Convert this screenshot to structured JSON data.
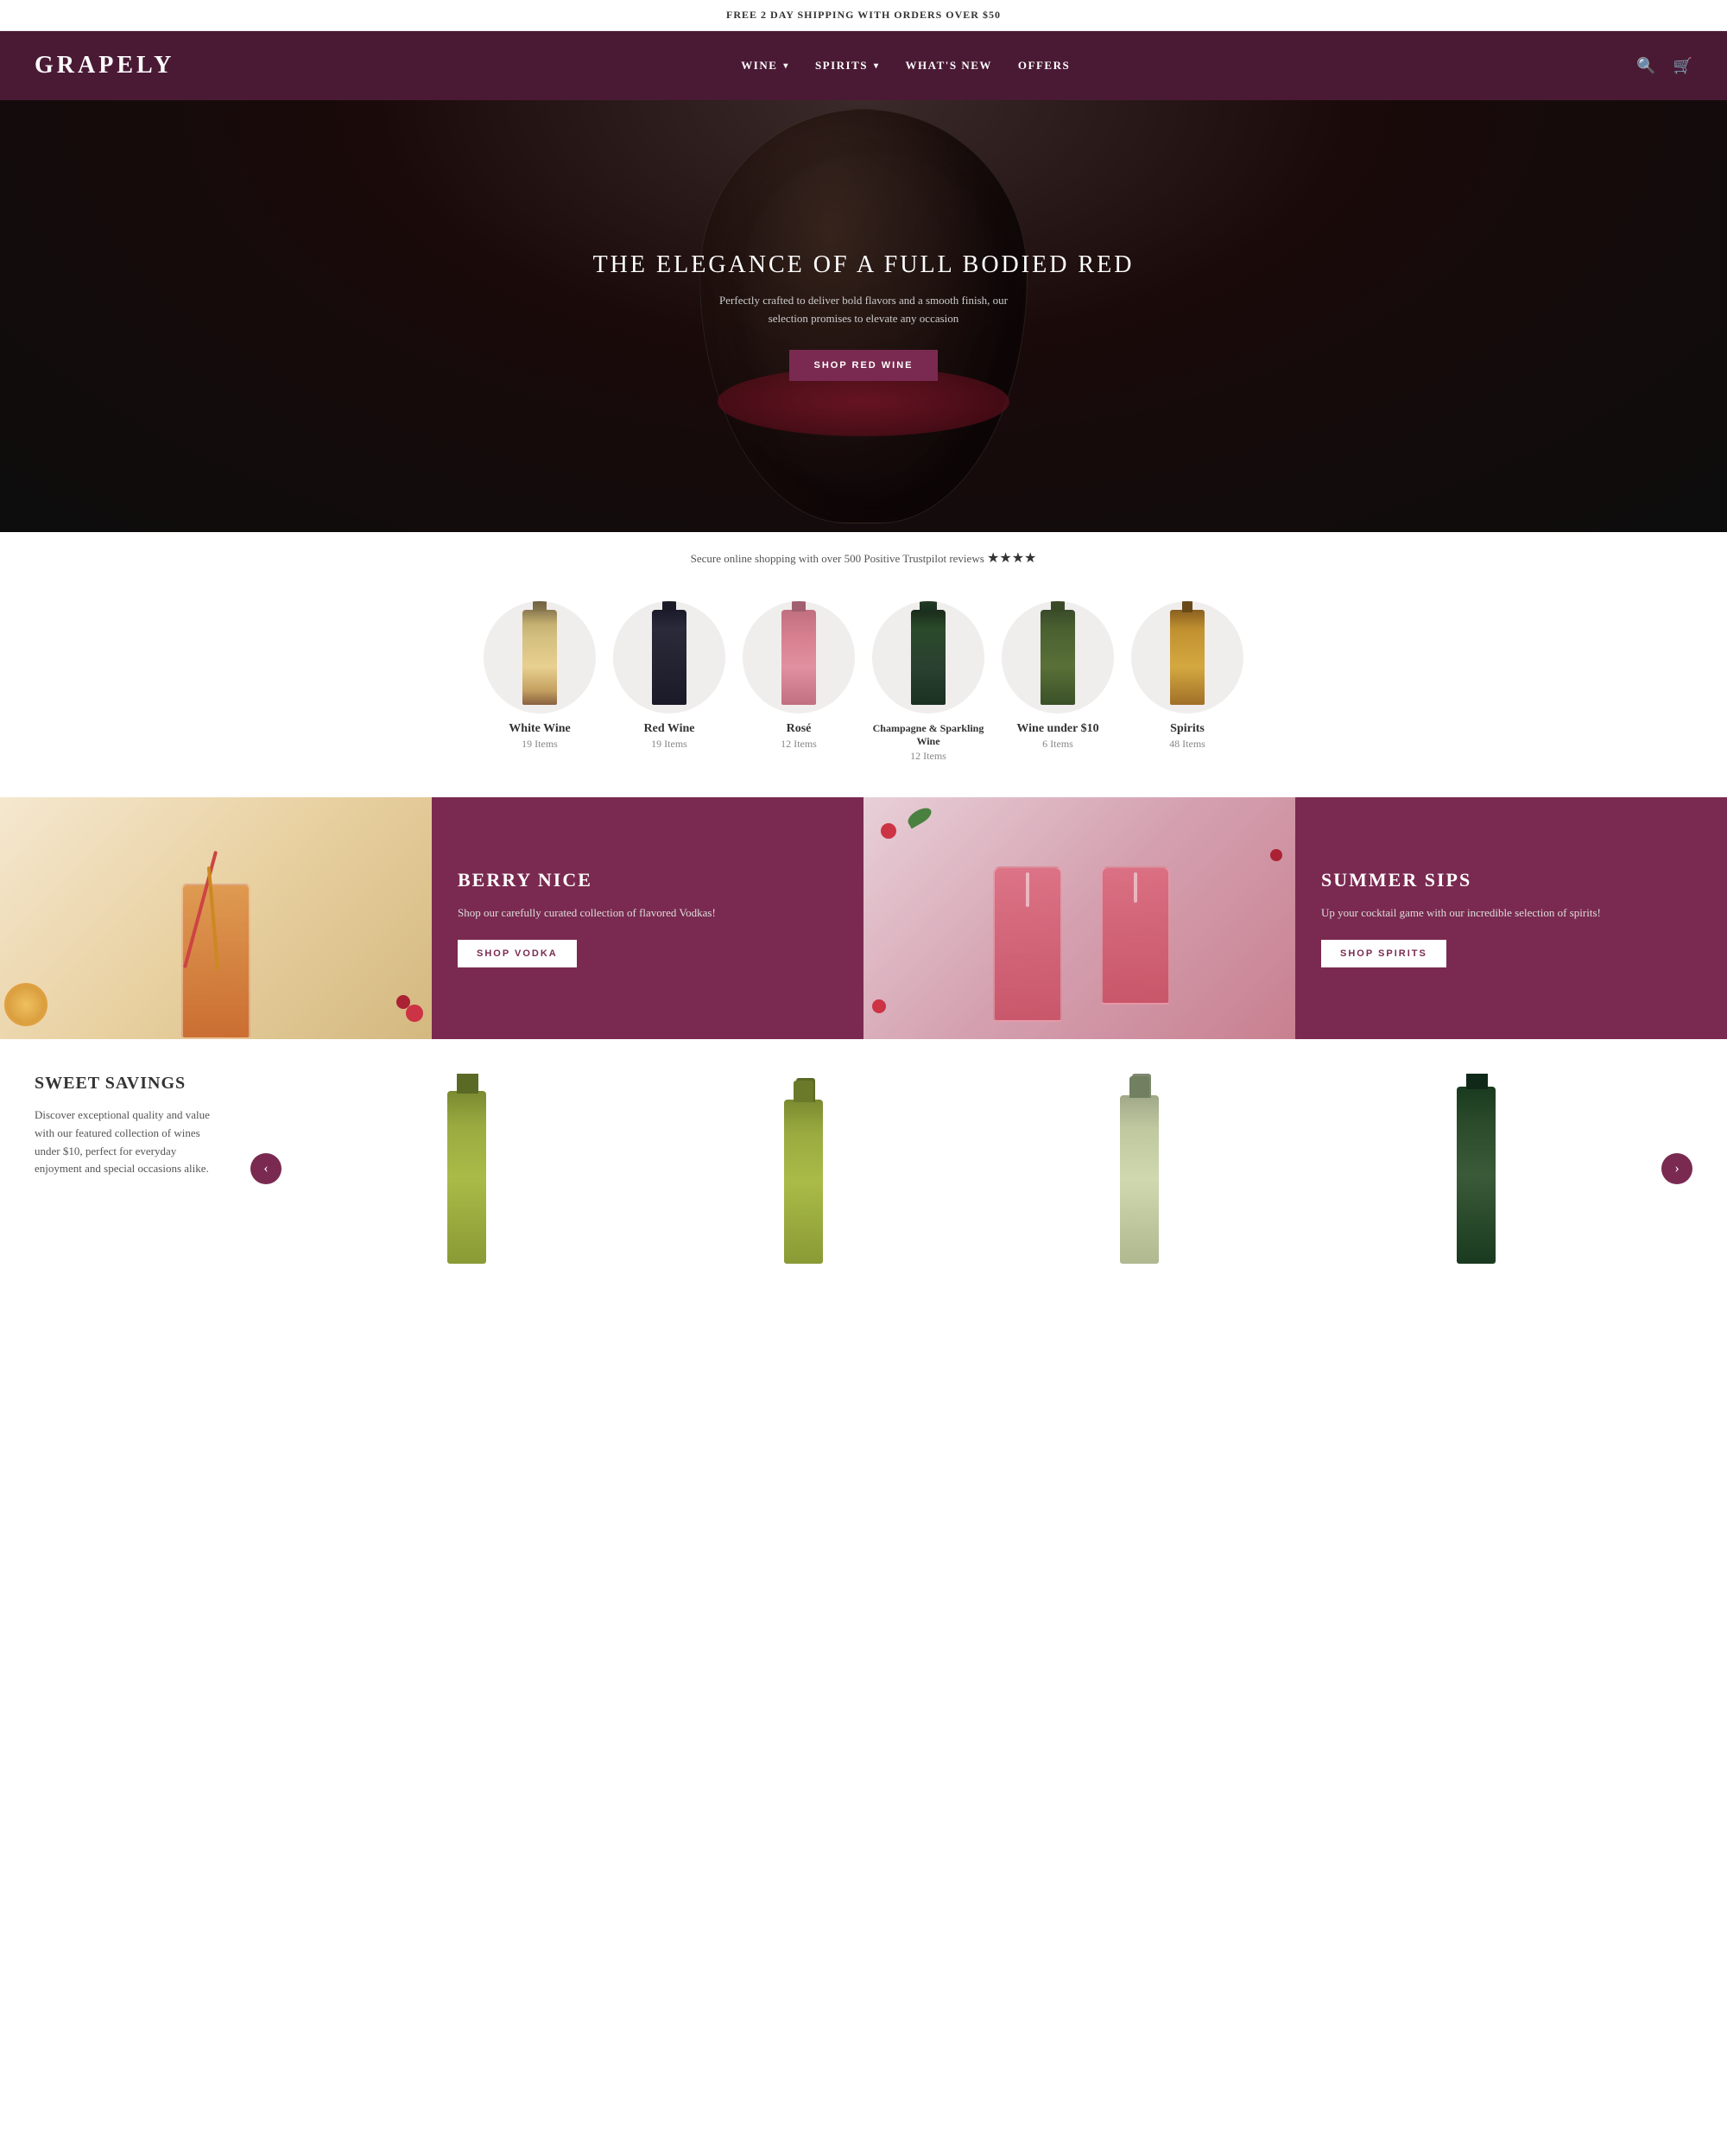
{
  "announcement": {
    "text": "FREE 2 DAY SHIPPING WITH ORDERS OVER $50"
  },
  "header": {
    "logo": "GRAPELY",
    "nav": [
      {
        "label": "WINE",
        "has_dropdown": true
      },
      {
        "label": "SPIRITS",
        "has_dropdown": true
      },
      {
        "label": "WHAT'S NEW",
        "has_dropdown": false
      },
      {
        "label": "OFFERS",
        "has_dropdown": false
      }
    ]
  },
  "hero": {
    "title": "THE ELEGANCE OF A FULL BODIED RED",
    "subtitle": "Perfectly crafted to deliver bold flavors and a smooth finish, our selection promises to elevate any occasion",
    "button_label": "SHOP RED WINE"
  },
  "trust_bar": {
    "text": "Secure online shopping with over 500 Positive Trustpilot reviews",
    "stars": "★★★★"
  },
  "categories": [
    {
      "name": "White Wine",
      "count": "19 Items",
      "bottle_type": "white"
    },
    {
      "name": "Red Wine",
      "count": "19 Items",
      "bottle_type": "red"
    },
    {
      "name": "Rosé",
      "count": "12 Items",
      "bottle_type": "rose"
    },
    {
      "name": "Champagne & Sparkling Wine",
      "count": "12 Items",
      "bottle_type": "champagne"
    },
    {
      "name": "Wine under $10",
      "count": "6 Items",
      "bottle_type": "budget"
    },
    {
      "name": "Spirits",
      "count": "48 Items",
      "bottle_type": "spirits"
    }
  ],
  "promo_left": {
    "title": "BERRY NICE",
    "text": "Shop our carefully curated collection of flavored Vodkas!",
    "button_label": "SHOP VODKA"
  },
  "promo_right": {
    "title": "SUMMER SIPS",
    "text": "Up your cocktail game with our incredible selection of spirits!",
    "button_label": "SHOP SPIRITS"
  },
  "sweet_savings": {
    "title": "SWEET SAVINGS",
    "text": "Discover exceptional quality and value with our featured collection of wines under $10, perfect for everyday enjoyment and special occasions alike."
  }
}
